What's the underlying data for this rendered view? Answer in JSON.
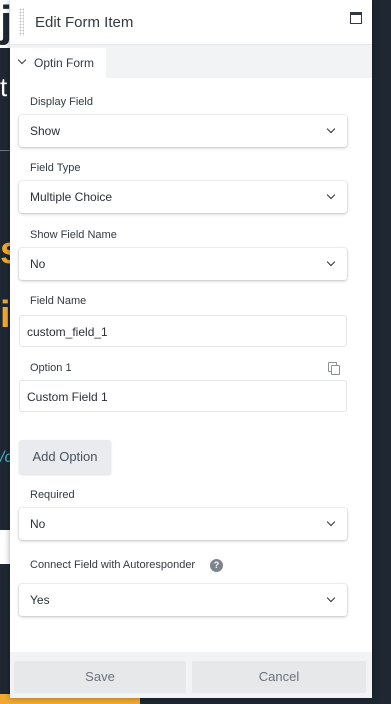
{
  "background": {
    "fragments": [
      "j",
      "t",
      "s",
      "i",
      "/c"
    ]
  },
  "modal": {
    "title": "Edit Form Item",
    "tab": "Optin Form"
  },
  "fields": {
    "display_field": {
      "label": "Display Field",
      "value": "Show"
    },
    "field_type": {
      "label": "Field Type",
      "value": "Multiple Choice"
    },
    "show_field_name": {
      "label": "Show Field Name",
      "value": "No"
    },
    "field_name": {
      "label": "Field Name",
      "value": "custom_field_1"
    },
    "option_1": {
      "label": "Option 1",
      "value": "Custom Field 1"
    },
    "required": {
      "label": "Required",
      "value": "No"
    },
    "connect_autoresponder": {
      "label": "Connect Field with Autoresponder",
      "value": "Yes"
    }
  },
  "buttons": {
    "add_option": "Add Option",
    "save": "Save",
    "cancel": "Cancel",
    "help": "?"
  },
  "colors": {
    "accent_orange": "#f0a830",
    "accent_teal": "#3fb6c6",
    "page_dark": "#1f2732"
  },
  "icons": [
    "drag-handle-icon",
    "maximize-icon",
    "chevron-down-icon",
    "copy-icon",
    "help-icon"
  ]
}
